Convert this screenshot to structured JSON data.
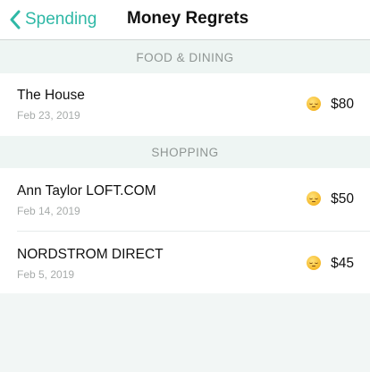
{
  "nav": {
    "back_label": "Spending",
    "title": "Money Regrets"
  },
  "sections": [
    {
      "header": "FOOD & DINING",
      "items": [
        {
          "name": "The House",
          "date": "Feb 23, 2019",
          "amount": "$80",
          "emoji": "disappointed-face-icon"
        }
      ]
    },
    {
      "header": "SHOPPING",
      "items": [
        {
          "name": "Ann Taylor LOFT.COM",
          "date": "Feb 14, 2019",
          "amount": "$50",
          "emoji": "disappointed-face-icon"
        },
        {
          "name": "NORDSTROM DIRECT",
          "date": "Feb 5, 2019",
          "amount": "$45",
          "emoji": "disappointed-face-icon"
        }
      ]
    }
  ],
  "colors": {
    "accent": "#2fb8a6",
    "background": "#f2f6f5"
  }
}
